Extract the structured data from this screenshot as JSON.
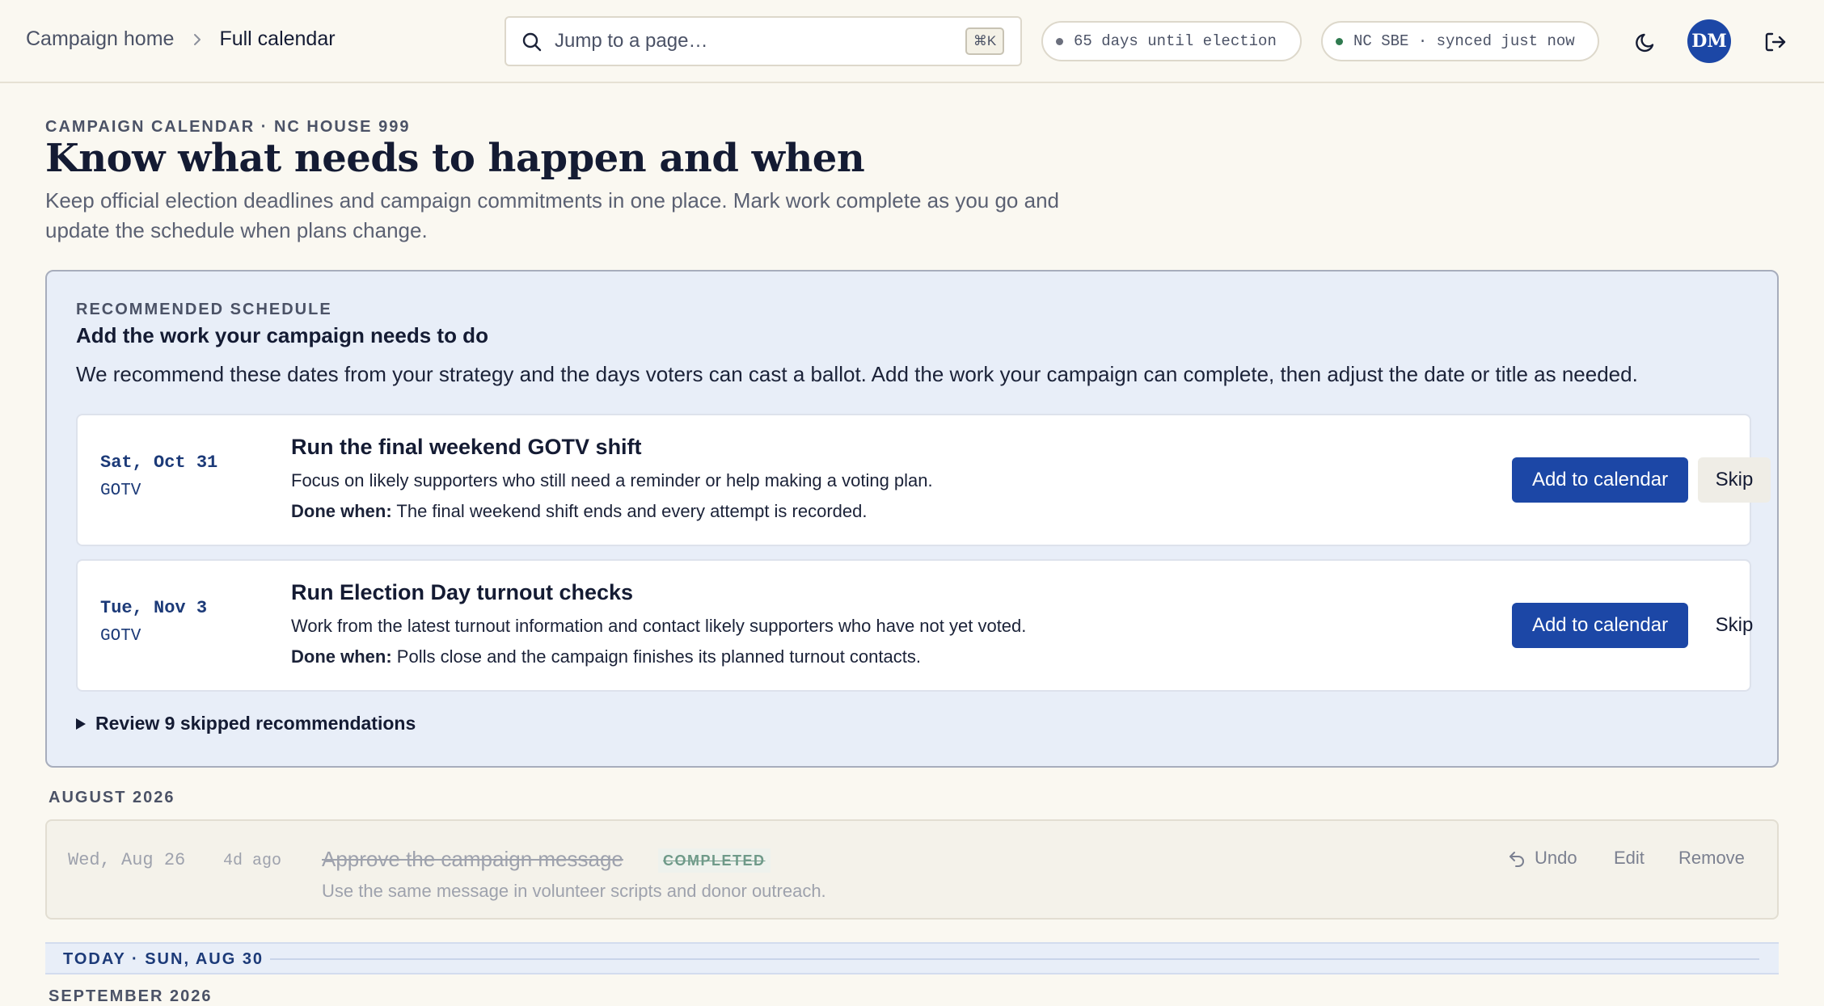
{
  "breadcrumb": {
    "home": "Campaign home",
    "current": "Full calendar"
  },
  "search": {
    "placeholder": "Jump to a page…",
    "shortcut": "⌘K"
  },
  "status": {
    "election_countdown": "65 days until election",
    "sync": "NC SBE · synced just now",
    "election_dot_color": "#6b6f7d",
    "sync_dot_color": "#2f7a4f"
  },
  "user": {
    "initials": "DM"
  },
  "header": {
    "eyebrow": "CAMPAIGN CALENDAR · NC HOUSE 999",
    "title": "Know what needs to happen and when",
    "intro": "Keep official election deadlines and campaign commitments in one place. Mark work complete as you go and update the schedule when plans change."
  },
  "recommended": {
    "eyebrow": "RECOMMENDED SCHEDULE",
    "title": "Add the work your campaign needs to do",
    "description": "We recommend these dates from your strategy and the days voters can cast a ballot. Add the work your campaign can complete, then adjust the date or title as needed.",
    "items": [
      {
        "date": "Sat, Oct 31",
        "category": "GOTV",
        "title": "Run the final weekend GOTV shift",
        "description": "Focus on likely supporters who still need a reminder or help making a voting plan.",
        "done_label": "Done when:",
        "done_when": "The final weekend shift ends and every attempt is recorded.",
        "add_label": "Add to calendar",
        "skip_label": "Skip"
      },
      {
        "date": "Tue, Nov 3",
        "category": "GOTV",
        "title": "Run Election Day turnout checks",
        "description": "Work from the latest turnout information and contact likely supporters who have not yet voted.",
        "done_label": "Done when:",
        "done_when": "Polls close and the campaign finishes its planned turnout contacts.",
        "add_label": "Add to calendar",
        "skip_label": "Skip"
      }
    ],
    "review_skipped": "Review 9 skipped recommendations"
  },
  "calendar": {
    "august": {
      "label": "AUGUST 2026",
      "events": [
        {
          "date": "Wed, Aug 26",
          "relative": "4d ago",
          "title": "Approve the campaign message",
          "badge": "COMPLETED",
          "description": "Use the same message in volunteer scripts and donor outreach.",
          "undo_label": "Undo",
          "edit_label": "Edit",
          "remove_label": "Remove"
        }
      ]
    },
    "today": "TODAY · SUN, AUG 30",
    "september": {
      "label": "SEPTEMBER 2026"
    }
  },
  "colors": {
    "accent": "#1c47a6",
    "panel": "#e8eef8",
    "background": "#faf8f1"
  }
}
